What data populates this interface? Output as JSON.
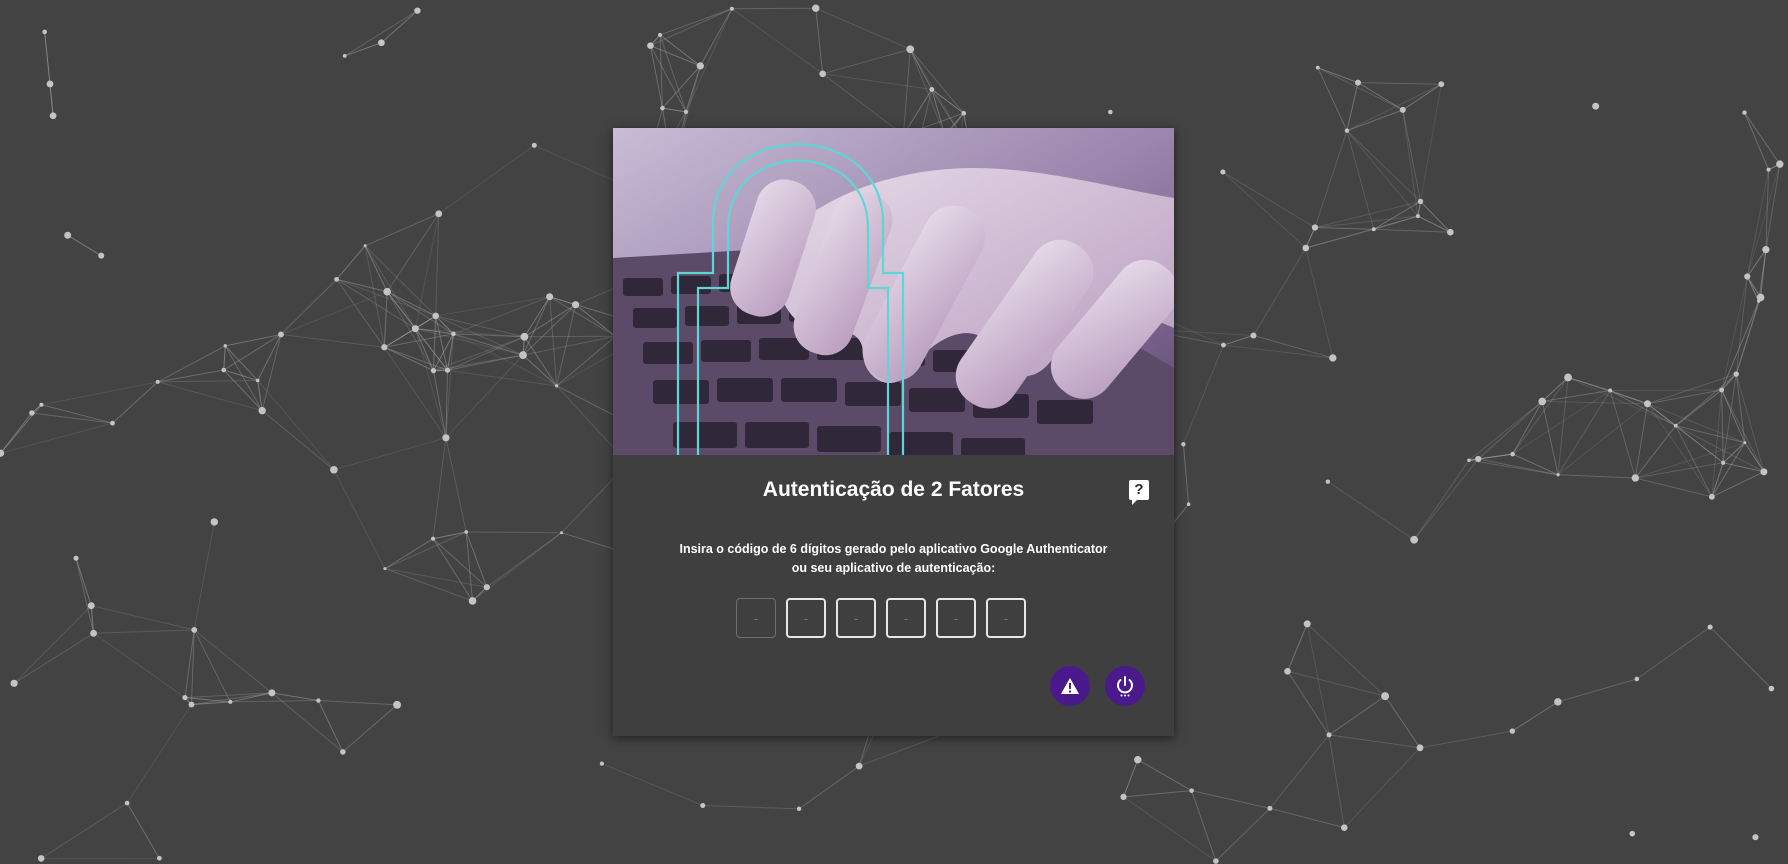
{
  "card": {
    "title": "Autenticação de 2 Fatores",
    "help_label": "?",
    "instruction_line1": "Insira o código de 6 dígitos gerado pelo aplicativo Google Authenticator",
    "instruction_line2": "ou seu aplicativo de autenticação:"
  },
  "code_inputs": [
    {
      "placeholder": "-"
    },
    {
      "placeholder": "-"
    },
    {
      "placeholder": "-"
    },
    {
      "placeholder": "-"
    },
    {
      "placeholder": "-"
    },
    {
      "placeholder": "-"
    }
  ],
  "actions": {
    "warning_icon": "warning-icon",
    "power_icon": "power-icon"
  },
  "colors": {
    "background": "#434343",
    "card": "#3f3f3f",
    "accent": "#4a1a8c",
    "lock_outline": "#5fd6d6"
  }
}
